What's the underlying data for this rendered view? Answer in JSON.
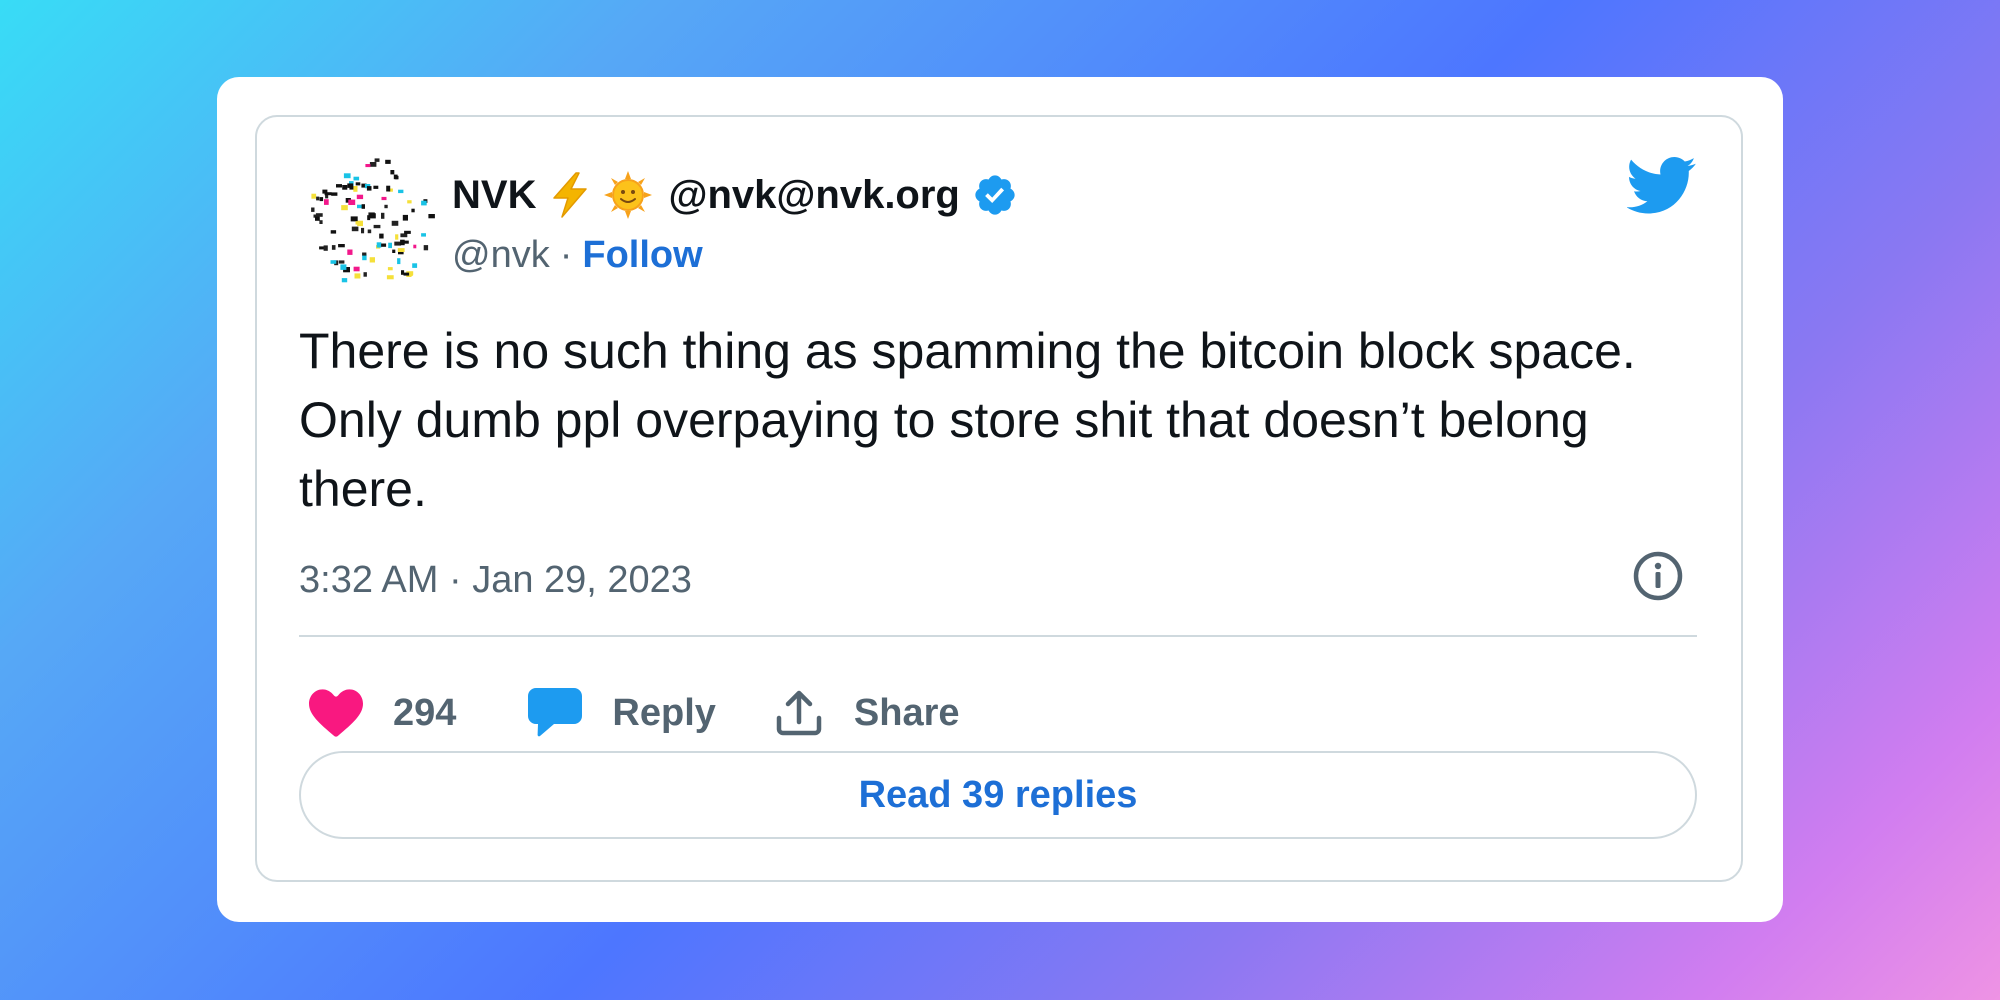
{
  "tweet": {
    "author": {
      "name": "NVK",
      "name_emojis": [
        "lightning-emoji",
        "sun-face-emoji"
      ],
      "display_handle": "@nvk@nvk.org",
      "verified": true,
      "handle": "@nvk",
      "separator": "·",
      "follow_label": "Follow"
    },
    "text": "There is no such thing as spamming the bitcoin block space. Only dumb ppl overpaying to store shit that doesn’t belong there.",
    "timestamp": "3:32 AM · Jan 29, 2023",
    "actions": {
      "like_count": "294",
      "reply_label": "Reply",
      "share_label": "Share"
    },
    "read_replies_label": "Read 39 replies"
  },
  "icons": {
    "brand": "twitter-bird-icon",
    "info": "info-icon",
    "like": "heart-icon",
    "reply": "speech-bubble-icon",
    "share": "share-upload-icon",
    "verified": "verified-badge-icon"
  },
  "colors": {
    "twitter_blue": "#1d9bf0",
    "link_blue": "#1d6fd6",
    "like_pink": "#f91880",
    "text_primary": "#0f1419",
    "text_secondary": "#536471",
    "border": "#cfd9de"
  }
}
